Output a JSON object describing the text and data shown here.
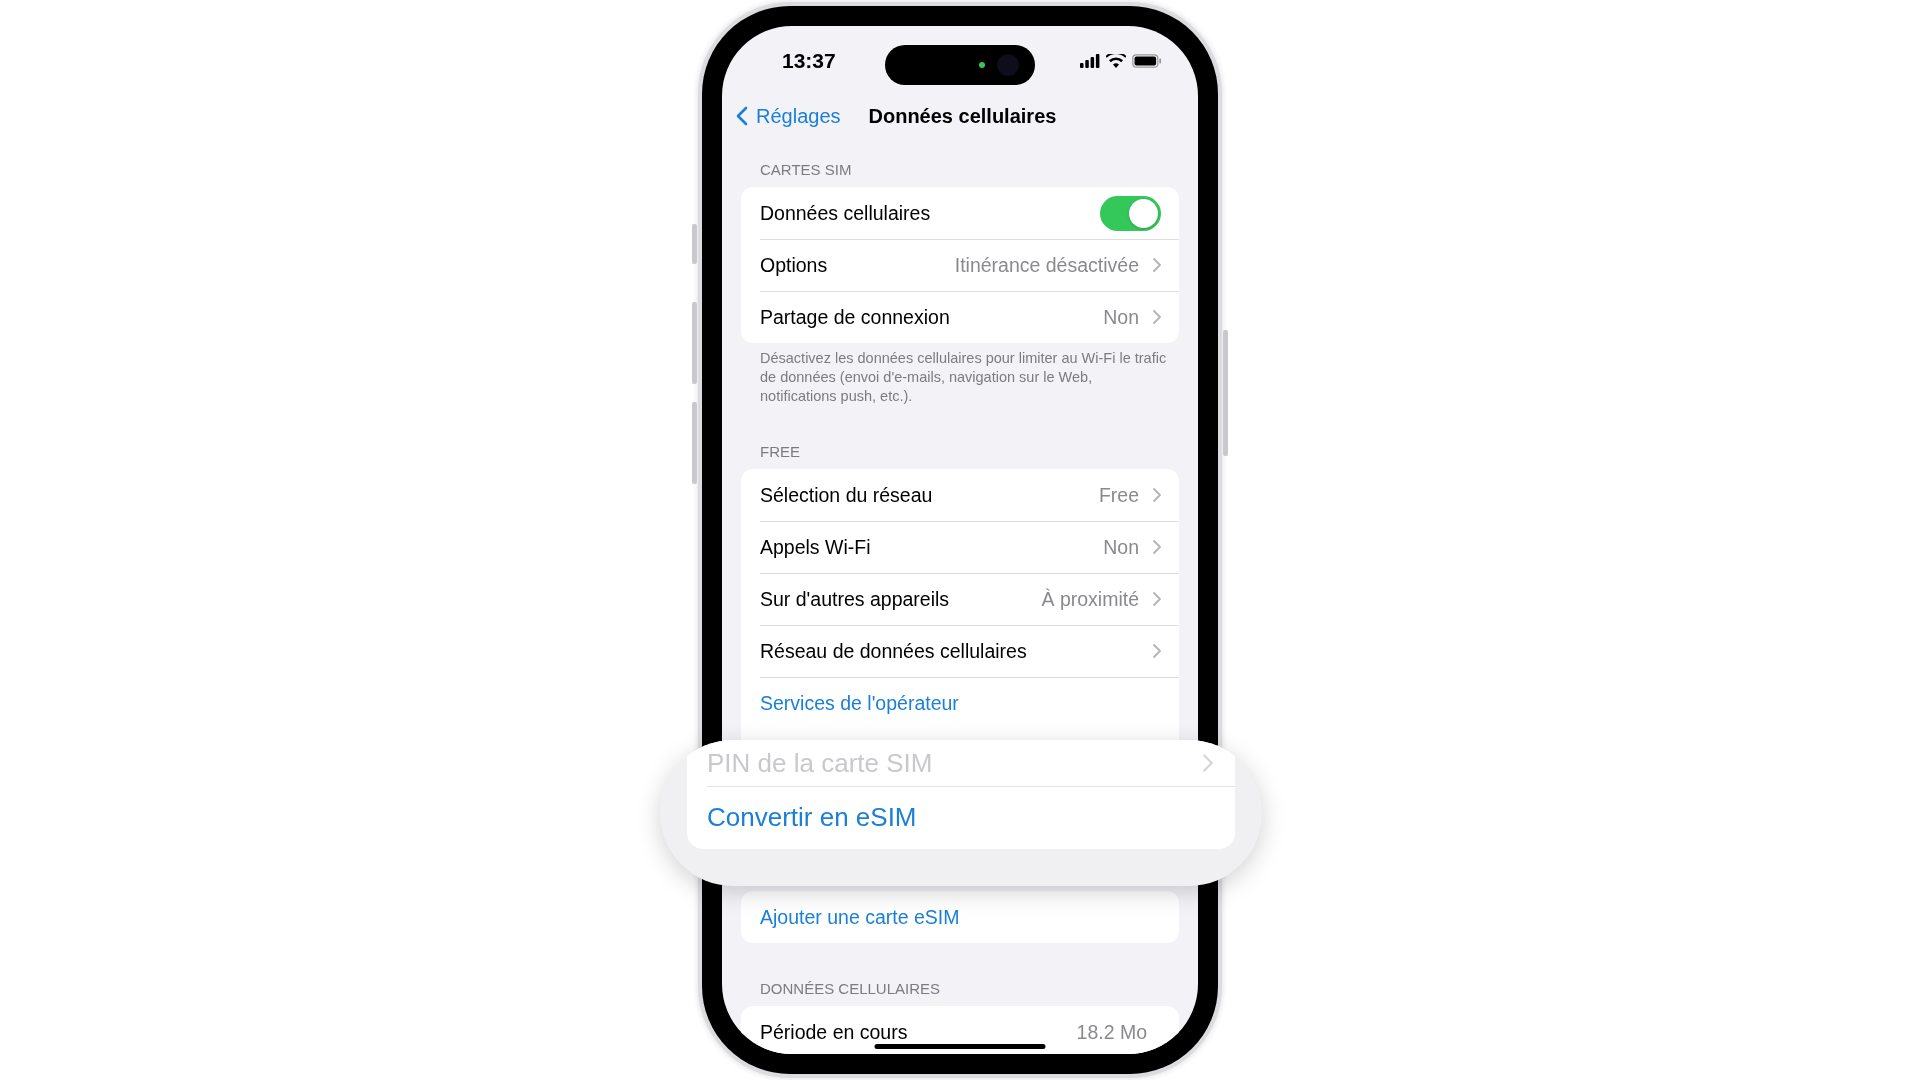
{
  "status_bar": {
    "time": "13:37"
  },
  "nav": {
    "back": "Réglages",
    "title": "Données cellulaires"
  },
  "sections": [
    {
      "header": "CARTES SIM",
      "rows": [
        {
          "kind": "toggle",
          "label": "Données cellulaires",
          "on": true
        },
        {
          "kind": "disclosure",
          "label": "Options",
          "value": "Itinérance désactivée"
        },
        {
          "kind": "disclosure",
          "label": "Partage de connexion",
          "value": "Non"
        }
      ],
      "footer": "Désactivez les données cellulaires pour limiter au Wi-Fi le trafic de données (envoi d'e-mails, navigation sur le Web, notifications push, etc.)."
    },
    {
      "header": "FREE",
      "rows": [
        {
          "kind": "disclosure",
          "label": "Sélection du réseau",
          "value": "Free"
        },
        {
          "kind": "disclosure",
          "label": "Appels Wi-Fi",
          "value": "Non"
        },
        {
          "kind": "disclosure",
          "label": "Sur d'autres appareils",
          "value": "À proximité"
        },
        {
          "kind": "disclosure",
          "label": "Réseau de données cellulaires"
        },
        {
          "kind": "link",
          "label": "Services de l'opérateur"
        }
      ],
      "magnifier": {
        "rows": [
          {
            "kind": "disclosure",
            "label": "PIN de la carte SIM",
            "disabled": true
          },
          {
            "kind": "link",
            "label": "Convertir en eSIM",
            "disabled": false
          }
        ]
      }
    },
    {
      "rows": [
        {
          "kind": "link",
          "label": "Ajouter une carte eSIM"
        }
      ]
    },
    {
      "header": "DONNÉES CELLULAIRES",
      "rows": [
        {
          "kind": "value",
          "label": "Période en cours",
          "value": "18.2 Mo"
        }
      ]
    }
  ]
}
